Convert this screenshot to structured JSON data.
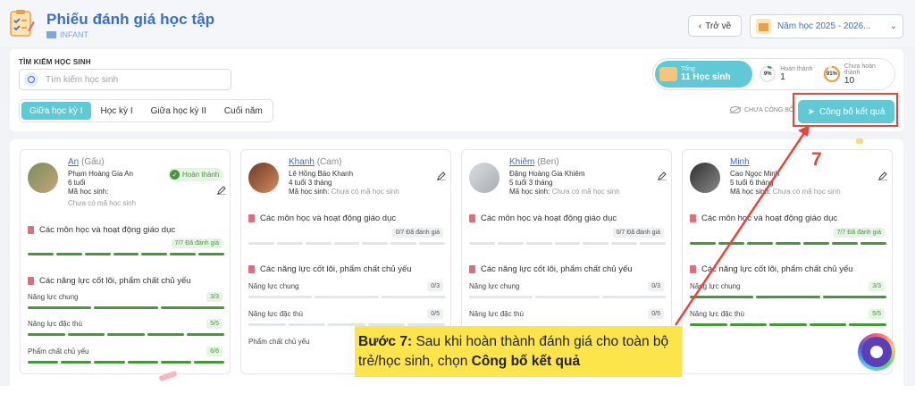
{
  "header": {
    "title": "Phiếu đánh giá học tập",
    "subtitle": "INFANT",
    "back_label": "Trở về",
    "school_year": "Năm học 2025 - 2026..."
  },
  "search": {
    "label": "TÌM KIẾM HỌC SINH",
    "placeholder": "Tìm kiếm học sinh"
  },
  "tabs": [
    {
      "label": "Giữa học kỳ I",
      "active": true
    },
    {
      "label": "Học kỳ I",
      "active": false
    },
    {
      "label": "Giữa học kỳ II",
      "active": false
    },
    {
      "label": "Cuối năm",
      "active": false
    }
  ],
  "stats": {
    "total_label": "Tổng",
    "total_value": "11 Học sinh",
    "done_pct": "9%",
    "done_label": "Hoàn thành",
    "done_value": "1",
    "notdone_pct": "91%",
    "notdone_label": "Chưa hoàn thành",
    "notdone_value": "10"
  },
  "publish": {
    "status_label": "CHƯA CÔNG BỐ",
    "button_label": "Công bố kết quả"
  },
  "labels": {
    "code_label": "Mã học sinh:",
    "code_empty": "Chưa có mã học sinh",
    "section_subjects": "Các môn học và hoạt động giáo dục",
    "section_competency": "Các năng lực cốt lõi, phẩm chất chủ yếu",
    "general": "Năng lực chung",
    "special": "Năng lực đặc thù",
    "quality": "Phẩm chất chủ yếu",
    "done_badge": "Hoàn thành"
  },
  "students": [
    {
      "nick": "An",
      "alias": "(Gấu)",
      "full_name": "Phạm Hoàng Gia An",
      "age": "6 tuổi",
      "done": true,
      "subjects": "7/7 Đã đánh giá",
      "subjects_frac": 1,
      "general": "3/3",
      "general_frac": 1,
      "special": "5/5",
      "special_frac": 1,
      "quality": "6/6",
      "quality_frac": 1
    },
    {
      "nick": "Khanh",
      "alias": "(Cam)",
      "full_name": "Lê Hồng Bảo Khanh",
      "age": "4 tuổi 3 tháng",
      "done": false,
      "subjects": "0/7 Đã đánh giá",
      "subjects_frac": 0,
      "general": "0/3",
      "general_frac": 0,
      "special": "0/5",
      "special_frac": 0
    },
    {
      "nick": "Khiêm",
      "alias": "(Ben)",
      "full_name": "Đặng Hoàng Gia Khiêm",
      "age": "5 tuổi 3 tháng",
      "done": false,
      "subjects": "0/7 Đã đánh giá",
      "subjects_frac": 0,
      "general": "0/3",
      "general_frac": 0,
      "special": "0/5",
      "special_frac": 0
    },
    {
      "nick": "Minh",
      "alias": "",
      "full_name": "Cao Ngọc Minh",
      "age": "5 tuổi 6 tháng",
      "done": false,
      "subjects": "7/7 Đã đánh giá",
      "subjects_frac": 1,
      "general": "3/3",
      "general_frac": 1,
      "special": "5/5",
      "special_frac": 1
    }
  ],
  "annotation": {
    "step_number": "7",
    "step_prefix": "Bước 7:",
    "text_1": "Sau khi hoàn thành đánh giá cho toàn bộ trẻ/học sinh, chọn",
    "text_bold": "Công bố kết quả"
  },
  "colors": {
    "accent": "#5fc9d6",
    "title_blue": "#3b6fc6",
    "done_green": "#46983a",
    "annotation_red": "#e8453c",
    "callout_yellow": "#fbe54a"
  }
}
